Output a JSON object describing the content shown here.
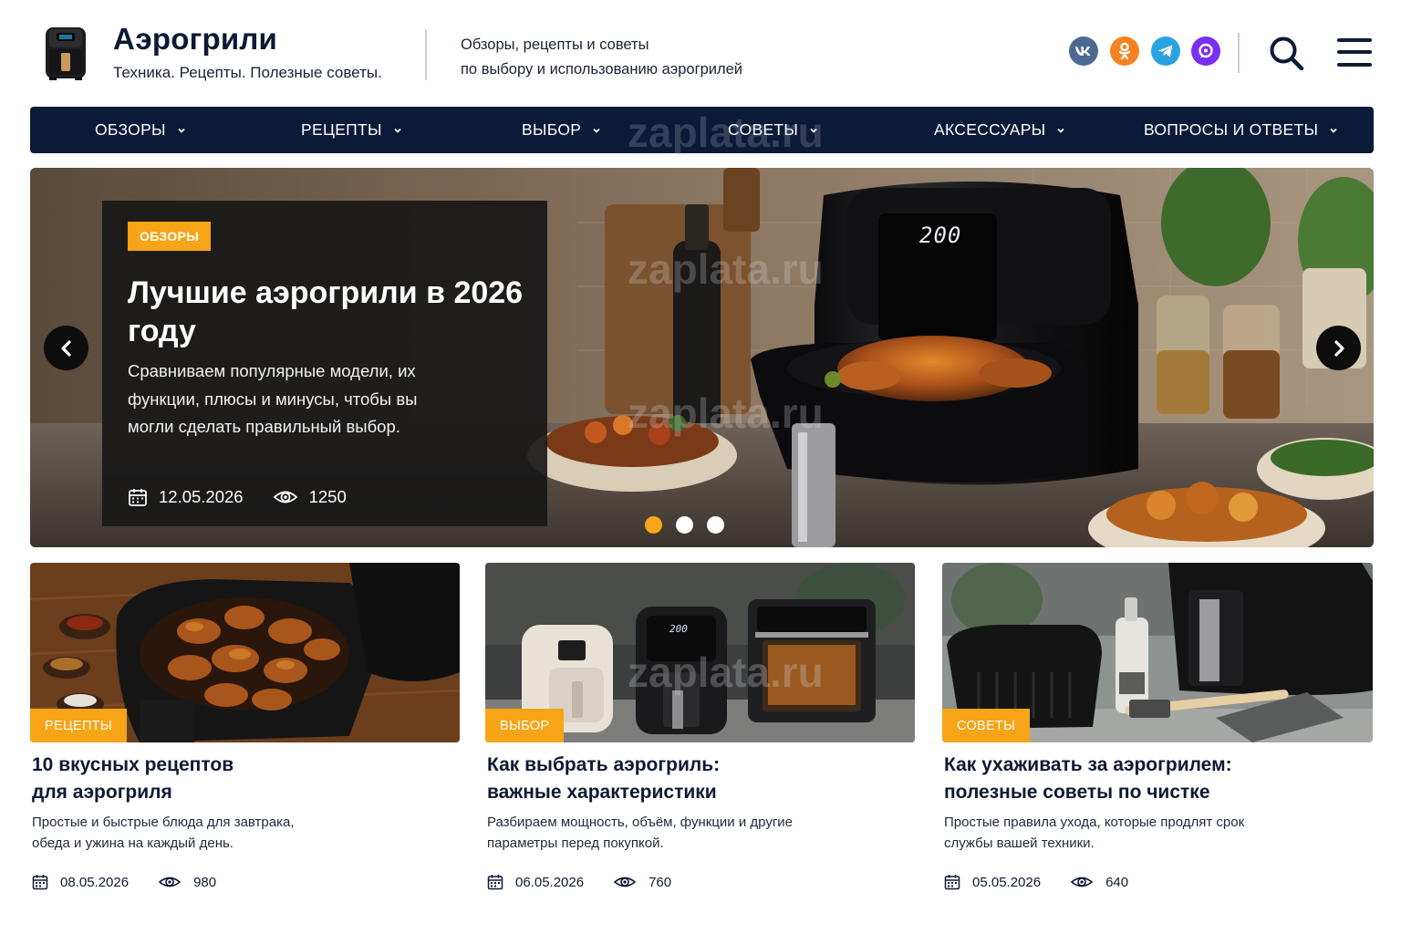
{
  "header": {
    "title": "Аэрогрили",
    "tagline": "Техника. Рецепты. Полезные советы.",
    "description_line1": "Обзоры, рецепты и советы",
    "description_line2": "по выбору и использованию аэрогрилей",
    "social": [
      {
        "name": "vk-icon",
        "label": "vk"
      },
      {
        "name": "ok-icon",
        "label": "ok"
      },
      {
        "name": "telegram-icon",
        "label": "tg"
      },
      {
        "name": "max-icon",
        "label": "max"
      }
    ]
  },
  "nav": {
    "items": [
      {
        "label": "ОБЗОРЫ"
      },
      {
        "label": "РЕЦЕПТЫ"
      },
      {
        "label": "ВЫБОР"
      },
      {
        "label": "СОВЕТЫ"
      },
      {
        "label": "АКСЕССУАРЫ"
      },
      {
        "label": "ВОПРОСЫ И ОТВЕТЫ"
      }
    ]
  },
  "hero": {
    "badge": "ОБЗОРЫ",
    "title": "Лучшие аэрогрили в 2026 году",
    "description": "Сравниваем популярные модели, их функции, плюсы и минусы, чтобы вы могли сделать правильный выбор.",
    "date": "12.05.2026",
    "views": "1250",
    "display_temp": "200",
    "slides_total": 3,
    "active_slide": 1
  },
  "cards": [
    {
      "badge": "РЕЦЕПТЫ",
      "title_line1": "10 вкусных рецептов",
      "title_line2": "для аэрогриля",
      "desc_line1": "Простые и быстрые блюда для завтрака,",
      "desc_line2": "обеда и ужина на каждый день.",
      "date": "08.05.2026",
      "views": "980"
    },
    {
      "badge": "ВЫБОР",
      "title_line1": "Как выбрать аэрогриль:",
      "title_line2": "важные характеристики",
      "desc_line1": "Разбираем мощность, объём, функции и другие",
      "desc_line2": "параметры перед покупкой.",
      "date": "06.05.2026",
      "views": "760"
    },
    {
      "badge": "СОВЕТЫ",
      "title_line1": "Как ухаживать за аэрогрилем:",
      "title_line2": "полезные советы по чистке",
      "desc_line1": "Простые правила ухода, которые продлят срок",
      "desc_line2": "службы вашей техники.",
      "date": "05.05.2026",
      "views": "640"
    }
  ],
  "colors": {
    "accent": "#f7a416",
    "nav_bg": "#0b1a38",
    "text_dark": "#0d1a33"
  },
  "watermark": "zaplata.ru"
}
